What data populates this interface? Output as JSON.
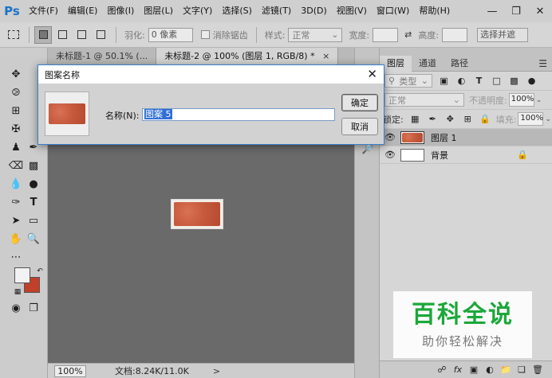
{
  "app": {
    "logo": "Ps",
    "menu": [
      "文件(F)",
      "编辑(E)",
      "图像(I)",
      "图层(L)",
      "文字(Y)",
      "选择(S)",
      "滤镜(T)",
      "3D(D)",
      "视图(V)",
      "窗口(W)",
      "帮助(H)"
    ],
    "window_controls": [
      "minimize-icon",
      "restore-icon",
      "close-icon"
    ]
  },
  "options_bar": {
    "feather_label": "羽化:",
    "feather_value": "0 像素",
    "antialias_label": "消除锯齿",
    "style_label": "样式:",
    "style_value": "正常",
    "width_label": "宽度:",
    "height_label": "高度:",
    "select_mask_label": "选择并遮"
  },
  "tabs": [
    {
      "label": "未标题-1 @ 50.1% (...",
      "active": false
    },
    {
      "label": "未标题-2 @ 100% (图层 1, RGB/8) *",
      "active": true
    }
  ],
  "status_bar": {
    "zoom": "100%",
    "doc_info": "文档:8.24K/11.0K",
    "arrow": ">"
  },
  "layers_panel": {
    "tabs": [
      "图层",
      "通道",
      "路径"
    ],
    "filter_label": "类型",
    "blend_mode": "正常",
    "opacity_label": "不透明度:",
    "opacity_value": "100%",
    "lock_label": "锁定:",
    "fill_label": "填充:",
    "fill_value": "100%",
    "layers": [
      {
        "name": "图层 1",
        "selected": true
      },
      {
        "name": "背景",
        "selected": false,
        "locked": true
      }
    ]
  },
  "dialog": {
    "title": "图案名称",
    "name_label": "名称(N):",
    "name_value": "图案 5",
    "ok_label": "确定",
    "cancel_label": "取消"
  },
  "watermark": {
    "title": "百科全说",
    "subtitle": "助你轻松解决"
  },
  "colors": {
    "foreground": "#f2f2f2",
    "background": "#c0402a",
    "brick": "#c75a3d",
    "accent": "#1ca73a"
  }
}
